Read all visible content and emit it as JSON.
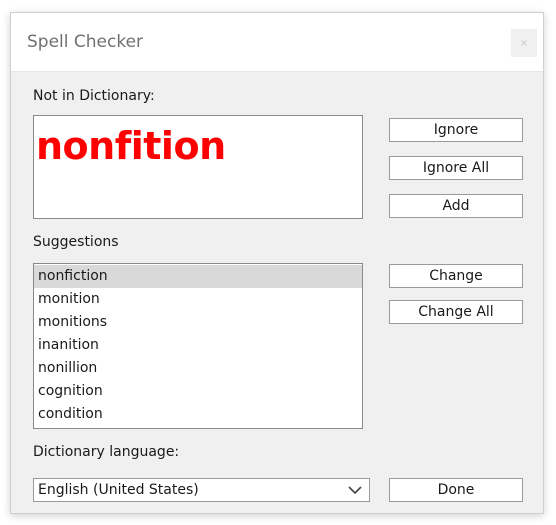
{
  "window": {
    "title": "Spell Checker",
    "close_glyph": "×"
  },
  "not_in_dictionary": {
    "label": "Not in Dictionary:",
    "word": "nonfition",
    "word_color": "#ff0000"
  },
  "buttons": {
    "ignore": "Ignore",
    "ignore_all": "Ignore All",
    "add": "Add",
    "change": "Change",
    "change_all": "Change All",
    "done": "Done"
  },
  "suggestions": {
    "label": "Suggestions",
    "items": [
      "nonfiction",
      "monition",
      "monitions",
      "inanition",
      "nonillion",
      "cognition",
      "condition"
    ],
    "selected_index": 0
  },
  "dictionary_language": {
    "label": "Dictionary language:",
    "value": "English (United States)",
    "icon": "chevron-down-icon"
  }
}
